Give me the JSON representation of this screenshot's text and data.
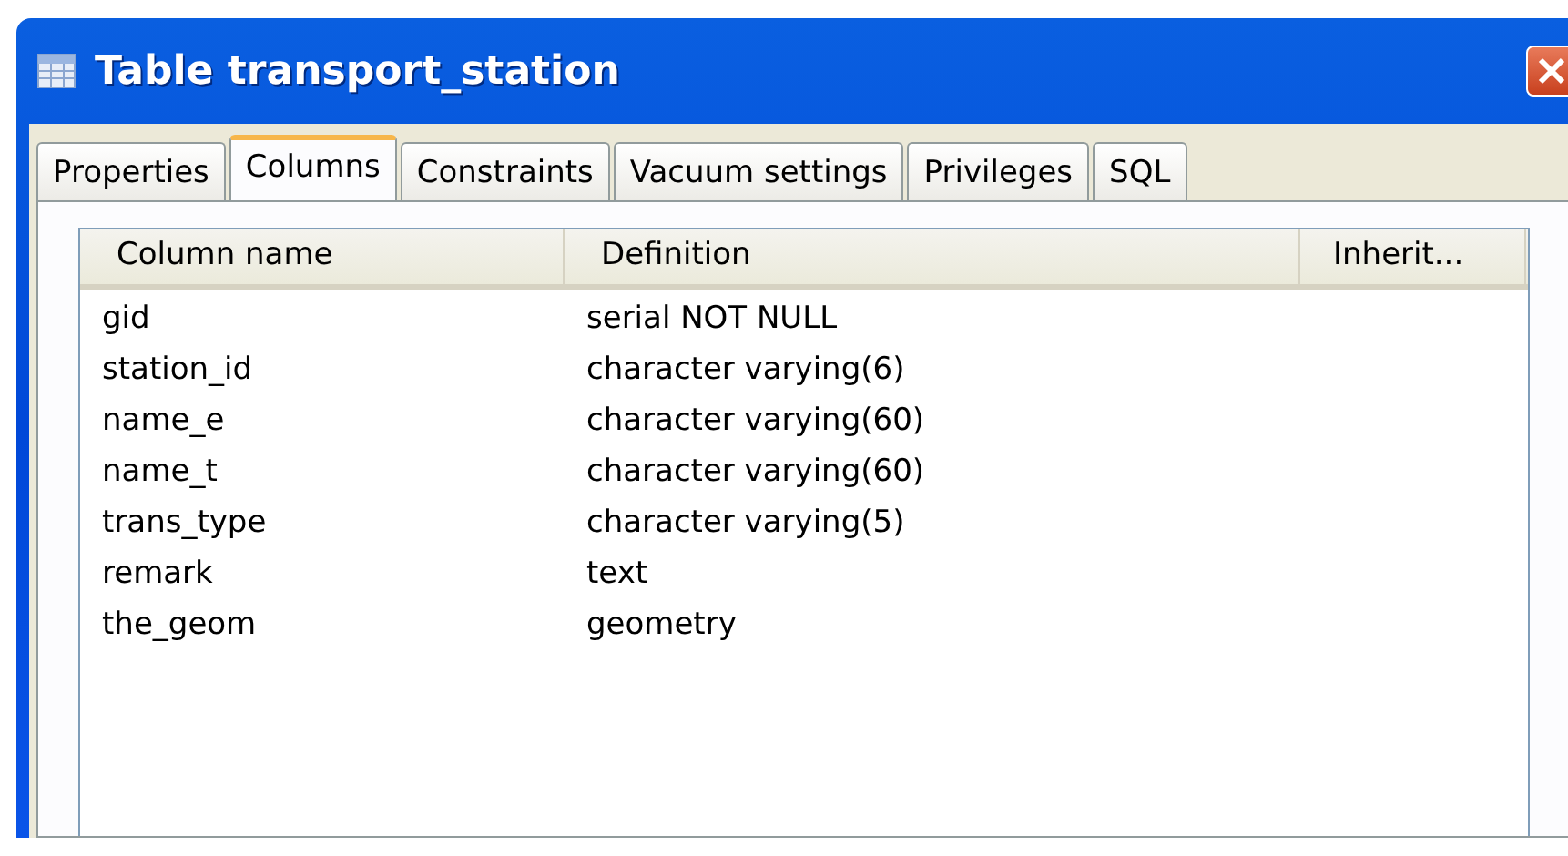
{
  "window": {
    "title": "Table transport_station"
  },
  "tabs": [
    {
      "label": "Properties",
      "selected": false
    },
    {
      "label": "Columns",
      "selected": true
    },
    {
      "label": "Constraints",
      "selected": false
    },
    {
      "label": "Vacuum settings",
      "selected": false
    },
    {
      "label": "Privileges",
      "selected": false
    },
    {
      "label": "SQL",
      "selected": false
    }
  ],
  "table": {
    "columns": [
      "Column name",
      "Definition",
      "Inherit..."
    ],
    "rows": [
      [
        "gid",
        "serial NOT NULL"
      ],
      [
        "station_id",
        "character varying(6)"
      ],
      [
        "name_e",
        "character varying(60)"
      ],
      [
        "name_t",
        "character varying(60)"
      ],
      [
        "trans_type",
        "character varying(5)"
      ],
      [
        "remark",
        "text"
      ],
      [
        "the_geom",
        "geometry"
      ]
    ]
  }
}
